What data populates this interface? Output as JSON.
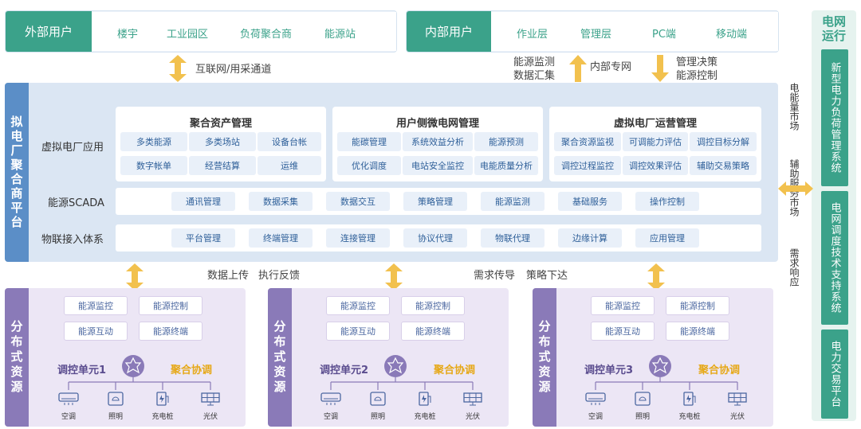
{
  "external_users": {
    "label": "外部用户",
    "items": [
      "楼宇",
      "工业园区",
      "负荷聚合商",
      "能源站"
    ]
  },
  "internal_users": {
    "label": "内部用户",
    "items": [
      "作业层",
      "管理层",
      "PC端",
      "移动端"
    ]
  },
  "channels": {
    "internet": "互联网/用采通道",
    "energy_monitor": "能源监测",
    "data_collect": "数据汇集",
    "private_net": "内部专网",
    "mgmt_decision": "管理决策",
    "energy_control": "能源控制"
  },
  "platform": {
    "title": "拟电厂聚合商平台",
    "app_label": "虚拟电厂应用",
    "cards": [
      {
        "title": "聚合资产管理",
        "items": [
          "多类能源",
          "多类场站",
          "设备台帐",
          "数字帐单",
          "经营结算",
          "运维"
        ]
      },
      {
        "title": "用户侧微电网管理",
        "items": [
          "能碳管理",
          "系统效益分析",
          "能源预测",
          "优化调度",
          "电站安全监控",
          "电能质量分析"
        ]
      },
      {
        "title": "虚拟电厂运营管理",
        "items": [
          "聚合资源监视",
          "可调能力评估",
          "调控目标分解",
          "调控过程监控",
          "调控效果评估",
          "辅助交易策略"
        ]
      }
    ],
    "scada": {
      "label": "能源SCADA",
      "items": [
        "通讯管理",
        "数据采集",
        "数据交互",
        "策略管理",
        "能源监测",
        "基础服务",
        "操作控制"
      ]
    },
    "iot": {
      "label": "物联接入体系",
      "items": [
        "平台管理",
        "终端管理",
        "连接管理",
        "协议代理",
        "物联代理",
        "边缘计算",
        "应用管理"
      ]
    }
  },
  "flows": {
    "up": "数据上传",
    "feedback": "执行反馈",
    "demand": "需求传导",
    "strategy": "策略下达"
  },
  "grid": {
    "title": "电网运行",
    "middle": [
      "电能量市场",
      "辅助服务市场",
      "需求响应"
    ],
    "boxes": [
      "新型电力负荷管理系统",
      "电网调度技术支持系统",
      "电力交易平台"
    ]
  },
  "distributed": {
    "title": "分布式资源",
    "chips": [
      "能源监控",
      "能源控制",
      "能源互动",
      "能源终端"
    ],
    "units": [
      "调控单元1",
      "调控单元2",
      "调控单元3"
    ],
    "agg": "聚合协调",
    "devices": [
      "空调",
      "照明",
      "充电桩",
      "光伏"
    ]
  },
  "colors": {
    "green": "#3ba28a",
    "blue": "#5b8ec7",
    "purple": "#8a7ab8",
    "gold": "#f2c14e"
  }
}
